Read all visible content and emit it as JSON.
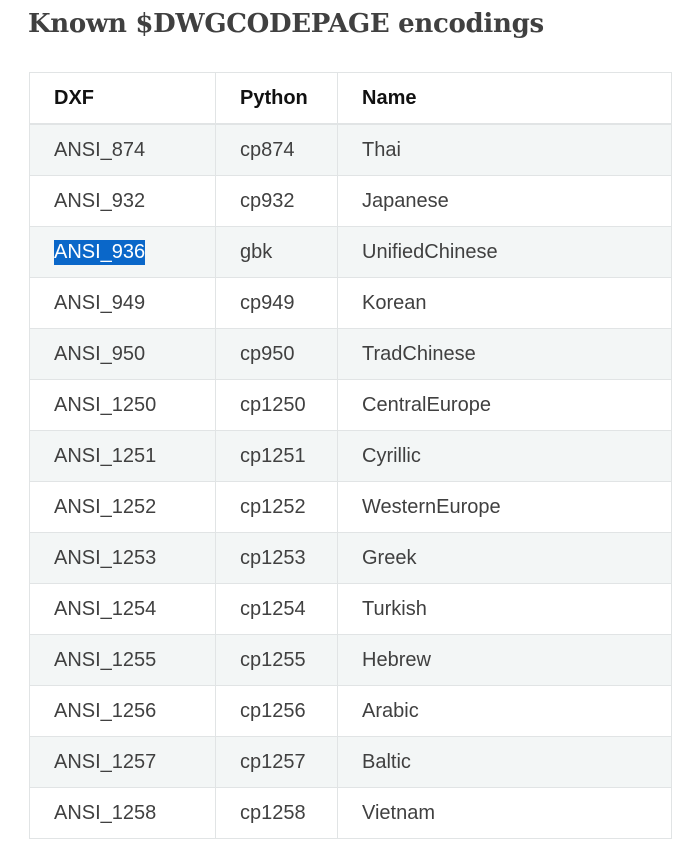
{
  "title": "Known $DWGCODEPAGE encodings",
  "table": {
    "headers": [
      "DXF",
      "Python",
      "Name"
    ],
    "rows": [
      [
        "ANSI_874",
        "cp874",
        "Thai"
      ],
      [
        "ANSI_932",
        "cp932",
        "Japanese"
      ],
      [
        "ANSI_936",
        "gbk",
        "UnifiedChinese"
      ],
      [
        "ANSI_949",
        "cp949",
        "Korean"
      ],
      [
        "ANSI_950",
        "cp950",
        "TradChinese"
      ],
      [
        "ANSI_1250",
        "cp1250",
        "CentralEurope"
      ],
      [
        "ANSI_1251",
        "cp1251",
        "Cyrillic"
      ],
      [
        "ANSI_1252",
        "cp1252",
        "WesternEurope"
      ],
      [
        "ANSI_1253",
        "cp1253",
        "Greek"
      ],
      [
        "ANSI_1254",
        "cp1254",
        "Turkish"
      ],
      [
        "ANSI_1255",
        "cp1255",
        "Hebrew"
      ],
      [
        "ANSI_1256",
        "cp1256",
        "Arabic"
      ],
      [
        "ANSI_1257",
        "cp1257",
        "Baltic"
      ],
      [
        "ANSI_1258",
        "cp1258",
        "Vietnam"
      ]
    ],
    "selected_text": "ANSI_936"
  },
  "colors": {
    "text": "#404040",
    "header_text": "#111111",
    "stripe": "#f3f6f6",
    "border": "#e1e4e5",
    "selection": "#0a67c9"
  }
}
